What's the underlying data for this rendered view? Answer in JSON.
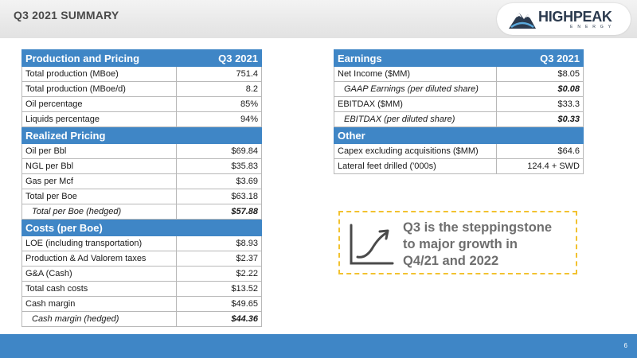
{
  "header": {
    "title": "Q3 2021 SUMMARY"
  },
  "logo": {
    "name_part1": "HIGH",
    "name_part2": "PEAK",
    "subtitle": "ENERGY"
  },
  "left_table": {
    "sections": [
      {
        "heading": "Production and Pricing",
        "heading_value": "Q3 2021",
        "rows": [
          {
            "label": "Total production (MBoe)",
            "value": "751.4",
            "italic": false
          },
          {
            "label": "Total production (MBoe/d)",
            "value": "8.2",
            "italic": false
          },
          {
            "label": "Oil percentage",
            "value": "85%",
            "italic": false
          },
          {
            "label": "Liquids percentage",
            "value": "94%",
            "italic": false
          }
        ]
      },
      {
        "heading": "Realized Pricing",
        "heading_value": "",
        "rows": [
          {
            "label": "Oil per Bbl",
            "value": "$69.84",
            "italic": false
          },
          {
            "label": "NGL per Bbl",
            "value": "$35.83",
            "italic": false
          },
          {
            "label": "Gas per Mcf",
            "value": "$3.69",
            "italic": false
          },
          {
            "label": "Total per Boe",
            "value": "$63.18",
            "italic": false
          },
          {
            "label": "Total per Boe (hedged)",
            "value": "$57.88",
            "italic": true
          }
        ]
      },
      {
        "heading": "Costs (per Boe)",
        "heading_value": "",
        "rows": [
          {
            "label": "LOE (including transportation)",
            "value": "$8.93",
            "italic": false
          },
          {
            "label": "Production & Ad Valorem taxes",
            "value": "$2.37",
            "italic": false
          },
          {
            "label": "G&A (Cash)",
            "value": "$2.22",
            "italic": false
          },
          {
            "label": "Total cash costs",
            "value": "$13.52",
            "italic": false
          },
          {
            "label": "Cash margin",
            "value": "$49.65",
            "italic": false
          },
          {
            "label": "Cash margin (hedged)",
            "value": "$44.36",
            "italic": true
          }
        ]
      }
    ]
  },
  "right_table": {
    "sections": [
      {
        "heading": "Earnings",
        "heading_value": "Q3 2021",
        "rows": [
          {
            "label": "Net Income ($MM)",
            "value": "$8.05",
            "italic": false
          },
          {
            "label": "GAAP Earnings (per diluted share)",
            "value": "$0.08",
            "italic": true
          },
          {
            "label": "EBITDAX ($MM)",
            "value": "$33.3",
            "italic": false
          },
          {
            "label": "EBITDAX (per diluted share)",
            "value": "$0.33",
            "italic": true
          }
        ]
      },
      {
        "heading": "Other",
        "heading_value": "",
        "rows": [
          {
            "label": "Capex excluding acquisitions ($MM)",
            "value": "$64.6",
            "italic": false
          },
          {
            "label": "Lateral feet drilled ('000s)",
            "value": "124.4 + SWD",
            "italic": false
          }
        ]
      }
    ]
  },
  "callout": {
    "lines": [
      "Q3 is the steppingstone",
      "to major growth in",
      "Q4/21 and 2022"
    ],
    "icon": "growth-chart-icon",
    "border_color": "#f2c230"
  },
  "footer": {
    "page_number": "6"
  },
  "colors": {
    "accent": "#3f86c6",
    "header_bg": "#e8e8e8",
    "callout_text": "#6e6e6e"
  }
}
